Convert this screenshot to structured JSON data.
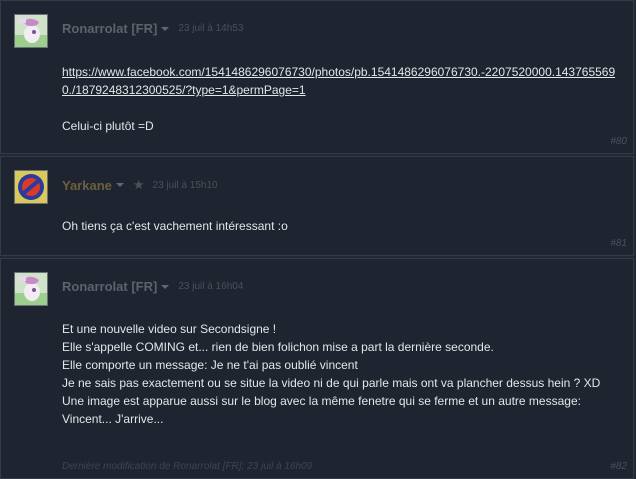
{
  "posts": [
    {
      "author": "Ronarrolat [FR]",
      "avatar_icon": "pony-avatar-icon",
      "time": "23 juil à 14h53",
      "link": "https://www.facebook.com/1541486296076730/photos/pb.1541486296076730.-2207520000.1437655690./1879248312300525/?type=1&permPage=1",
      "text": "Celui-ci plutôt =D",
      "number": "#80"
    },
    {
      "author": "Yarkane",
      "avatar_icon": "no-entry-sign-icon",
      "time": "23 juil à 15h10",
      "text": "Oh tiens ça c'est vachement intéressant :o",
      "number": "#81"
    },
    {
      "author": "Ronarrolat [FR]",
      "avatar_icon": "pony-avatar-icon",
      "time": "23 juil à 16h04",
      "lines": [
        "Et une nouvelle video sur Secondsigne !",
        "Elle s'appelle COMING et... rien de bien folichon mise a part la dernière seconde.",
        "Elle comporte un message: Je ne t'ai pas oublié vincent",
        "Je ne sais pas exactement ou se situe la video ni de qui parle mais ont va plancher dessus hein ? XD",
        "Une image est apparue aussi sur le blog avec la même fenetre qui se ferme et un autre message: Vincent... J'arrive..."
      ],
      "edited": "Dernière modification de Ronarrolat [FR]; 23 juil à 16h09",
      "number": "#82"
    }
  ]
}
